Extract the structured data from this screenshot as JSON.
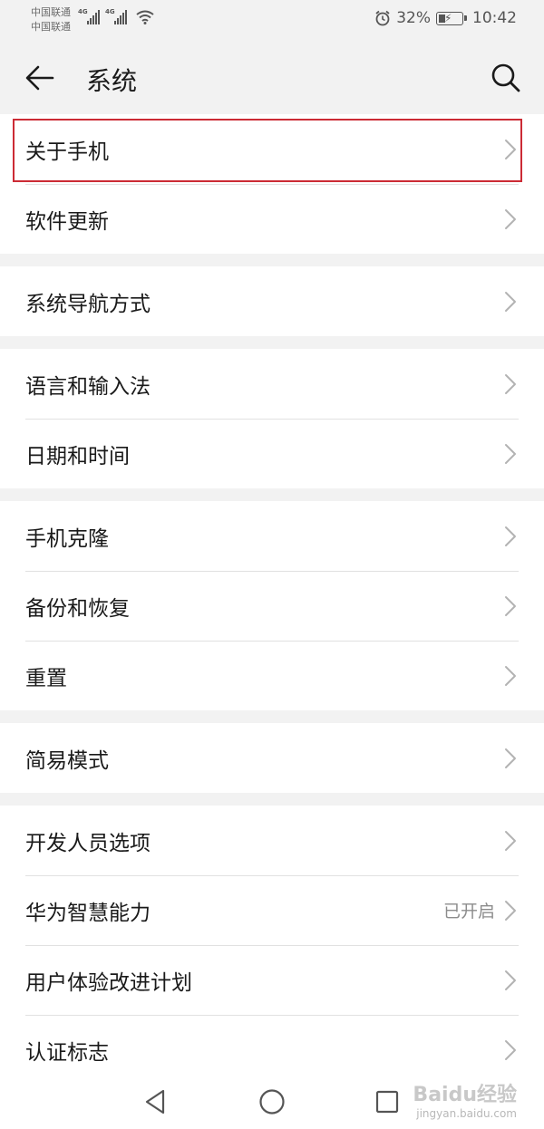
{
  "status_bar": {
    "carrier1": "中国联通",
    "carrier2": "中国联通",
    "network1": "4G",
    "network2": "4G",
    "battery": "32%",
    "battery_level": 0.32,
    "time": "10:42"
  },
  "header": {
    "title": "系统"
  },
  "groups": [
    {
      "items": [
        {
          "label": "关于手机",
          "highlighted": true
        },
        {
          "label": "软件更新"
        }
      ]
    },
    {
      "items": [
        {
          "label": "系统导航方式"
        }
      ]
    },
    {
      "items": [
        {
          "label": "语言和输入法"
        },
        {
          "label": "日期和时间"
        }
      ]
    },
    {
      "items": [
        {
          "label": "手机克隆"
        },
        {
          "label": "备份和恢复"
        },
        {
          "label": "重置"
        }
      ]
    },
    {
      "items": [
        {
          "label": "简易模式"
        }
      ]
    },
    {
      "items": [
        {
          "label": "开发人员选项"
        },
        {
          "label": "华为智慧能力",
          "value": "已开启"
        },
        {
          "label": "用户体验改进计划"
        },
        {
          "label": "认证标志"
        }
      ]
    }
  ],
  "colors": {
    "highlight_border": "#cc2b35",
    "background": "#f2f2f2"
  },
  "watermark": {
    "brand": "Baidu经验",
    "url": "jingyan.baidu.com"
  }
}
